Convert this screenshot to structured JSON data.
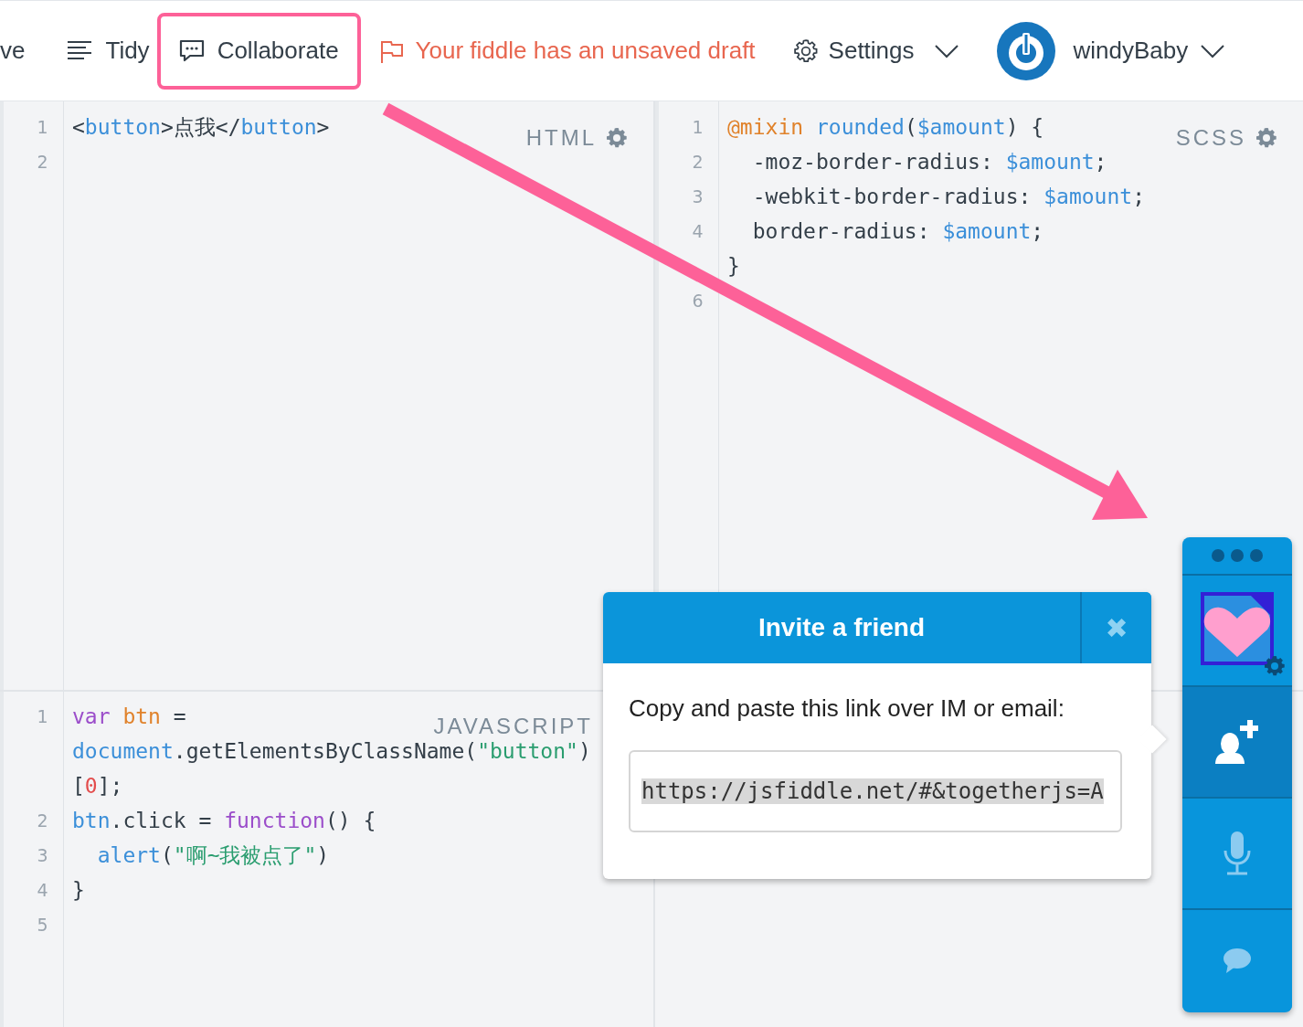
{
  "toolbar": {
    "items": [
      {
        "kind": "text",
        "label": "ve",
        "highlighted": false
      },
      {
        "kind": "tidy",
        "label": "Tidy",
        "highlighted": false
      },
      {
        "kind": "collaborate",
        "label": "Collaborate",
        "highlighted": true
      }
    ],
    "draft_notice": "Your fiddle has an unsaved draft",
    "settings": {
      "label": "Settings"
    },
    "user": {
      "name": "windyBaby"
    }
  },
  "panels": [
    {
      "language": "HTML",
      "gear": true,
      "lines": [
        {
          "number": "1",
          "tokens": [
            {
              "kind": "plain",
              "text": "<"
            },
            {
              "kind": "tag",
              "text": "button"
            },
            {
              "kind": "plain",
              "text": ">点我</"
            },
            {
              "kind": "tag",
              "text": "button"
            },
            {
              "kind": "plain",
              "text": ">"
            }
          ]
        },
        {
          "number": "2"
        }
      ]
    },
    {
      "language": "SCSS",
      "gear": true,
      "lines": [
        {
          "number": "1",
          "tokens": [
            {
              "kind": "atrule",
              "text": "@mixin "
            },
            {
              "kind": "func",
              "text": "rounded"
            },
            {
              "kind": "plain",
              "text": "("
            },
            {
              "kind": "var",
              "text": "$amount"
            },
            {
              "kind": "plain",
              "text": ") {"
            }
          ]
        },
        {
          "number": "2",
          "tokens": [
            {
              "kind": "plain",
              "text": "  -moz-border-radius: "
            },
            {
              "kind": "var",
              "text": "$amount"
            },
            {
              "kind": "plain",
              "text": ";"
            }
          ]
        },
        {
          "number": "3",
          "tokens": [
            {
              "kind": "plain",
              "text": "  -webkit-border-radius: "
            },
            {
              "kind": "var",
              "text": "$amount"
            },
            {
              "kind": "plain",
              "text": ";"
            }
          ]
        },
        {
          "number": "4",
          "tokens": [
            {
              "kind": "plain",
              "text": "  border-radius: "
            },
            {
              "kind": "var",
              "text": "$amount"
            },
            {
              "kind": "plain",
              "text": ";"
            }
          ]
        },
        {
          "tokens": [
            {
              "kind": "plain",
              "text": "}"
            }
          ]
        },
        {
          "number": "6"
        }
      ]
    },
    {
      "language": "JAVASCRIPT",
      "gear": false,
      "lines": [
        {
          "number": "1",
          "tokens": [
            {
              "kind": "keyword",
              "text": "var "
            },
            {
              "kind": "def",
              "text": "btn"
            },
            {
              "kind": "plain",
              "text": " ="
            }
          ]
        },
        {
          "tokens": [
            {
              "kind": "func",
              "text": "document"
            },
            {
              "kind": "plain",
              "text": ".getElementsByClassName("
            },
            {
              "kind": "string",
              "text": "\"button\""
            },
            {
              "kind": "plain",
              "text": ")"
            }
          ]
        },
        {
          "tokens": [
            {
              "kind": "plain",
              "text": "["
            },
            {
              "kind": "number",
              "text": "0"
            },
            {
              "kind": "plain",
              "text": "];"
            }
          ]
        },
        {
          "number": "2",
          "tokens": [
            {
              "kind": "func",
              "text": "btn"
            },
            {
              "kind": "plain",
              "text": ".click = "
            },
            {
              "kind": "keyword",
              "text": "function"
            },
            {
              "kind": "plain",
              "text": "() {"
            }
          ]
        },
        {
          "number": "3",
          "tokens": [
            {
              "kind": "func",
              "text": "  alert"
            },
            {
              "kind": "plain",
              "text": "("
            },
            {
              "kind": "string",
              "text": "\"啊~我被点了\""
            },
            {
              "kind": "plain",
              "text": ")"
            }
          ]
        },
        {
          "number": "4",
          "tokens": [
            {
              "kind": "plain",
              "text": "}"
            }
          ]
        },
        {
          "number": "5"
        }
      ]
    }
  ],
  "invite_dialog": {
    "title": "Invite a friend",
    "close": "✖",
    "message": "Copy and paste this link over IM or email:",
    "link": "https://jsfiddle.net/#&togetherjs=A"
  },
  "dock": {
    "items": [
      {
        "kind": "avatar",
        "selected": false
      },
      {
        "kind": "invite",
        "selected": true
      },
      {
        "kind": "mic",
        "selected": false
      },
      {
        "kind": "chat",
        "selected": false
      }
    ]
  }
}
